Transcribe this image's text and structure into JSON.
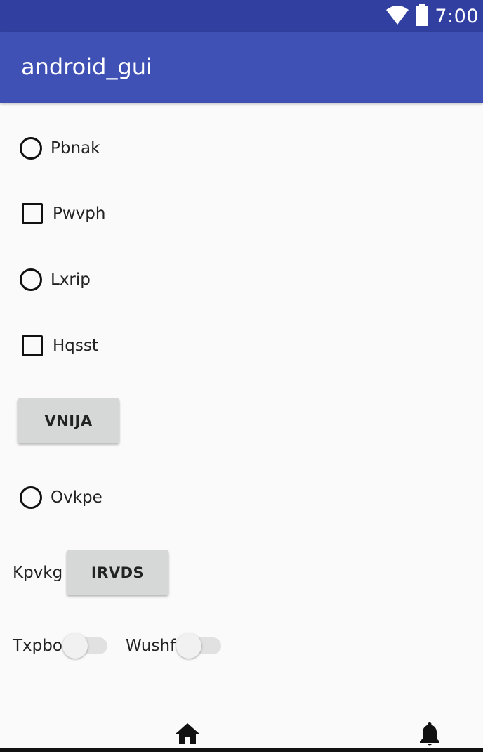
{
  "status_bar": {
    "time": "7:00",
    "icons": [
      "wifi-icon",
      "battery-icon"
    ],
    "color": "#3140a0"
  },
  "app_bar": {
    "title": "android_gui",
    "color": "#3f51b5"
  },
  "controls": {
    "radio_1": {
      "label": "Pbnak",
      "checked": false
    },
    "checkbox_1": {
      "label": "Pwvph",
      "checked": false
    },
    "radio_2": {
      "label": "Lxrip",
      "checked": false
    },
    "checkbox_2": {
      "label": "Hqsst",
      "checked": false
    },
    "button_1": {
      "label": "VNIJA"
    },
    "radio_3": {
      "label": "Ovkpe",
      "checked": false
    },
    "text_1": "Kpvkg",
    "button_2": {
      "label": "IRVDS"
    },
    "switch_1": {
      "label": "Txpbo",
      "on": false
    },
    "switch_2": {
      "label": "Wushf",
      "on": false
    }
  },
  "bottom_nav": {
    "icons": [
      "home-icon",
      "bell-icon"
    ]
  }
}
